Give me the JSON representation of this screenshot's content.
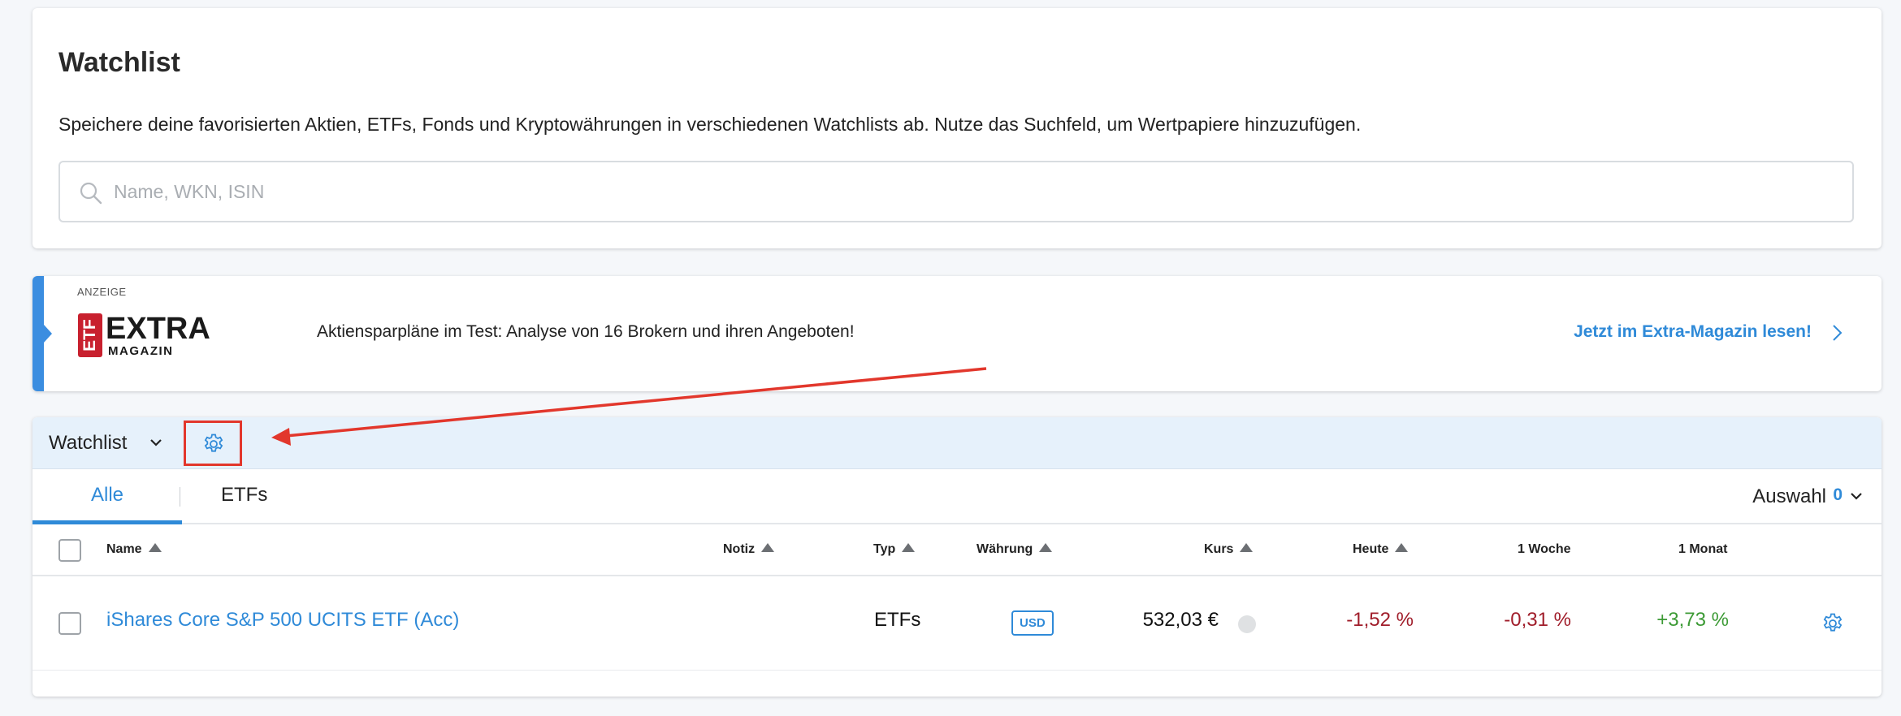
{
  "header": {
    "title": "Watchlist",
    "description": "Speichere deine favorisierten Aktien, ETFs, Fonds und Kryptowährungen in verschiedenen Watchlists ab. Nutze das Suchfeld, um Wertpapiere hinzuzufügen.",
    "search_placeholder": "Name, WKN, ISIN"
  },
  "ad": {
    "label": "ANZEIGE",
    "logo_etf": "ETF",
    "logo_extra": "EXTRA",
    "logo_magazin": "MAGAZIN",
    "text": "Aktiensparpläne im Test: Analyse von 16 Brokern und ihren Angeboten!",
    "cta": "Jetzt im Extra-Magazin lesen!"
  },
  "watchlist": {
    "selected": "Watchlist",
    "tabs": [
      {
        "label": "Alle",
        "active": true
      },
      {
        "label": "ETFs",
        "active": false
      }
    ],
    "auswahl_label": "Auswahl",
    "auswahl_count": "0",
    "columns": {
      "name": "Name",
      "notiz": "Notiz",
      "typ": "Typ",
      "waehrung": "Währung",
      "kurs": "Kurs",
      "heute": "Heute",
      "woche": "1 Woche",
      "monat": "1 Monat"
    },
    "rows": [
      {
        "name": "iShares Core S&P 500 UCITS ETF (Acc)",
        "typ": "ETFs",
        "waehrung": "USD",
        "kurs": "532,03 €",
        "heute": "-1,52 %",
        "woche": "-0,31 %",
        "monat": "+3,73 %"
      }
    ]
  },
  "colors": {
    "accent": "#2f8ad8",
    "negative": "#a01d2a",
    "positive": "#3c9a35",
    "annotation": "#e2372c",
    "logo_red": "#c8202e"
  },
  "icons": {
    "search": "search-icon",
    "settings": "gear-icon",
    "dropdown": "chevron-down-icon",
    "link": "chevron-right-icon"
  }
}
